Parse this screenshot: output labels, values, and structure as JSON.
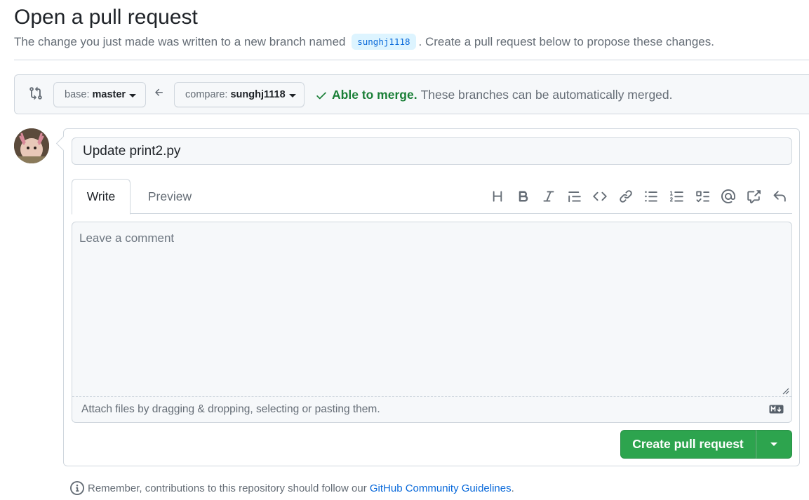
{
  "header": {
    "title": "Open a pull request",
    "subtitle_before": "The change you just made was written to a new branch named",
    "branch_name": "sunghj1118",
    "subtitle_after": ". Create a pull request below to propose these changes."
  },
  "range": {
    "base_label": "base:",
    "base_value": "master",
    "compare_label": "compare:",
    "compare_value": "sunghj1118",
    "merge_ok": "Able to merge.",
    "merge_desc": "These branches can be automatically merged."
  },
  "form": {
    "title_value": "Update print2.py",
    "tabs": [
      "Write",
      "Preview"
    ],
    "comment_placeholder": "Leave a comment",
    "attach_text": "Attach files by dragging & dropping, selecting or pasting them.",
    "toolbar_icons": [
      "heading-icon",
      "bold-icon",
      "italic-icon",
      "quote-icon",
      "code-icon",
      "link-icon",
      "unordered-list-icon",
      "ordered-list-icon",
      "task-list-icon",
      "mention-icon",
      "cross-reference-icon",
      "reply-icon"
    ],
    "submit_label": "Create pull request"
  },
  "footer": {
    "note_before": "Remember, contributions to this repository should follow our",
    "link_text": "GitHub Community Guidelines",
    "note_after": "."
  },
  "colors": {
    "success": "#1a7f37",
    "button_green": "#2da44e",
    "link": "#0969da",
    "muted": "#656d76"
  }
}
